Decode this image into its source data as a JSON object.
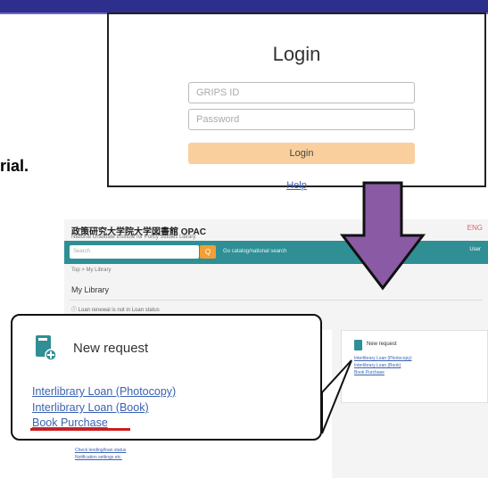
{
  "side_text": "rial.",
  "login": {
    "title": "Login",
    "id_placeholder": "GRIPS ID",
    "password_placeholder": "Password",
    "button_label": "Login",
    "help_link": "Help"
  },
  "opac": {
    "title": "政策研究大学院大学図書館 OPAC",
    "subtitle": "National Graduate Institute for Policy Studies Library",
    "language": "ENG",
    "search_placeholder": "Search",
    "search_button": "Q",
    "bar_link": "Go catalog/national search",
    "user_label": "User",
    "breadcrumb": "Top > My Library",
    "heading": "My Library",
    "note": "ⓘ Loan renewal is not in Loan status",
    "box_title": "New request",
    "box_links": [
      "Interlibrary Loan (Photocopy)",
      "Interlibrary Loan (Book)",
      "Book Purchase"
    ],
    "left_links": [
      "Check lending/loan status",
      "Notification settings etc."
    ]
  },
  "callout": {
    "title": "New request",
    "links": [
      "Interlibrary Loan (Photocopy)",
      "Interlibrary Loan (Book)",
      "Book Purchase"
    ]
  },
  "colors": {
    "top_bar": "#2e2f8c",
    "arrow_fill": "#8a5aa5",
    "teal": "#2f8f95",
    "link": "#3a62b3",
    "login_button": "#f9cf9e",
    "highlight": "#d01b1b"
  }
}
